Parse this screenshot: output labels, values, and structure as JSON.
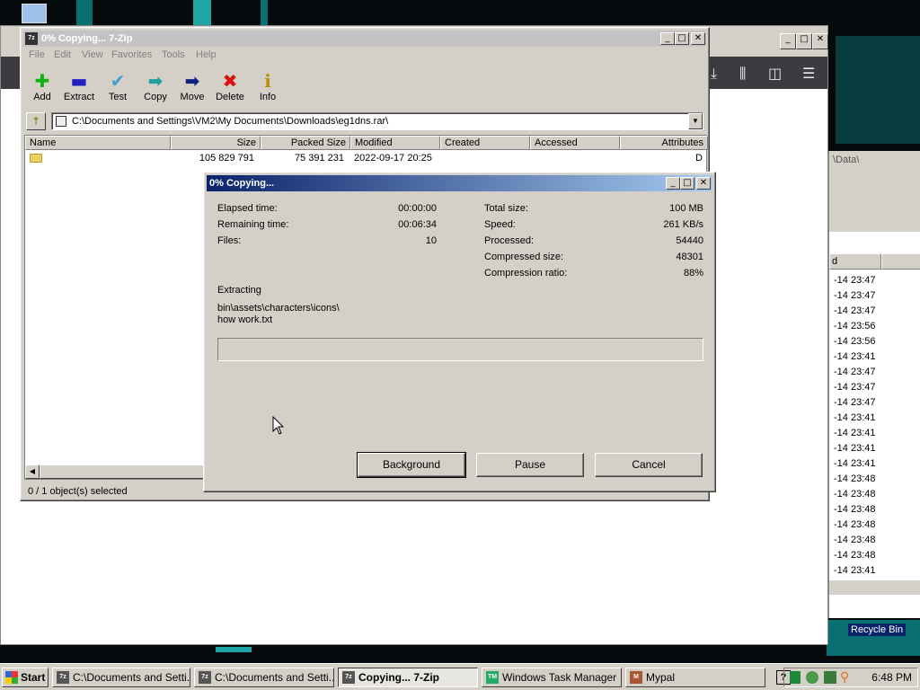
{
  "colors": {
    "desktop": "#050a0c",
    "window_face": "#d4d0c8",
    "title_active_start": "#0a246a",
    "title_active_end": "#a6caf0",
    "title_inactive": "#c3c3c3"
  },
  "desktop": {
    "recycle_bin_label": "Recycle Bin",
    "icon": "computer-icon"
  },
  "explorer_bg": {
    "path_fragment": "\\Data\\",
    "column_header": "d",
    "rows": [
      "-14 23:47",
      "-14 23:47",
      "-14 23:47",
      "-14 23:56",
      "-14 23:56",
      "-14 23:41",
      "-14 23:47",
      "-14 23:47",
      "-14 23:47",
      "-14 23:41",
      "-14 23:41",
      "-14 23:41",
      "-14 23:41",
      "-14 23:48",
      "-14 23:48",
      "-14 23:48",
      "-14 23:48",
      "-14 23:48",
      "-14 23:48",
      "-14 23:41"
    ]
  },
  "zip_main": {
    "title": "0% Copying... 7-Zip",
    "app_badge": "7z",
    "menu": [
      "File",
      "Edit",
      "View",
      "Favorites",
      "Tools",
      "Help"
    ],
    "toolbar": [
      {
        "label": "Add",
        "icon": "plus-icon",
        "glyph": "✚",
        "color": "#10b010"
      },
      {
        "label": "Extract",
        "icon": "minus-icon",
        "glyph": "▬",
        "color": "#2020c0"
      },
      {
        "label": "Test",
        "icon": "check-icon",
        "glyph": "✔",
        "color": "#40a0d0"
      },
      {
        "label": "Copy",
        "icon": "copy-arrow-icon",
        "glyph": "➡",
        "color": "#20a0a0"
      },
      {
        "label": "Move",
        "icon": "move-arrow-icon",
        "glyph": "➡",
        "color": "#102080"
      },
      {
        "label": "Delete",
        "icon": "delete-x-icon",
        "glyph": "✖",
        "color": "#e01010"
      },
      {
        "label": "Info",
        "icon": "info-icon",
        "glyph": "i",
        "color": "#b89000"
      }
    ],
    "path": "C:\\Documents and Settings\\VM2\\My Documents\\Downloads\\eg1dns.rar\\",
    "columns": [
      "Name",
      "Size",
      "Packed Size",
      "Modified",
      "Created",
      "Accessed",
      "Attributes"
    ],
    "rows": [
      {
        "name": "",
        "size": "105 829 791",
        "packed": "75 391 231",
        "modified": "2022-09-17 20:25",
        "created": "",
        "accessed": "",
        "attributes": "D"
      }
    ],
    "status": "0 / 1 object(s) selected"
  },
  "dialog": {
    "title": "0% Copying...",
    "left_stats": [
      {
        "label": "Elapsed time:",
        "value": "00:00:00"
      },
      {
        "label": "Remaining time:",
        "value": "00:06:34"
      },
      {
        "label": "Files:",
        "value": "10"
      }
    ],
    "right_stats": [
      {
        "label": "Total size:",
        "value": "100 MB"
      },
      {
        "label": "Speed:",
        "value": "261 KB/s"
      },
      {
        "label": "Processed:",
        "value": "54440"
      },
      {
        "label": "Compressed size:",
        "value": "48301"
      },
      {
        "label": "Compression ratio:",
        "value": "88%"
      }
    ],
    "operation": "Extracting",
    "current_path": "bin\\assets\\characters\\icons\\",
    "current_file": "how work.txt",
    "progress": 0,
    "buttons": {
      "background": "Background",
      "pause": "Pause",
      "cancel": "Cancel"
    }
  },
  "taskbar": {
    "start": "Start",
    "items": [
      {
        "label": "C:\\Documents and Setti...",
        "badge": "7z",
        "active": false
      },
      {
        "label": "C:\\Documents and Setti...",
        "badge": "7z",
        "active": false
      },
      {
        "label": "Copying... 7-Zip",
        "badge": "7z",
        "active": true
      },
      {
        "label": "Windows Task Manager",
        "badge": "TM",
        "active": false
      },
      {
        "label": "Mypal",
        "badge": "M",
        "active": false
      }
    ],
    "clock": "6:48 PM"
  }
}
